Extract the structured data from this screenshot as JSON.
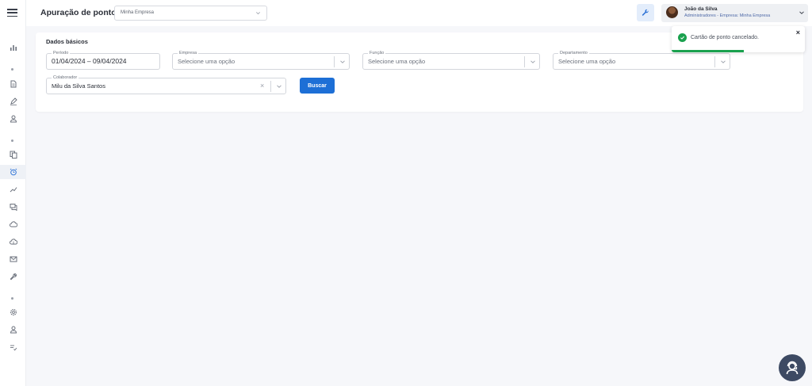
{
  "header": {
    "title": "Apuração de ponto",
    "company_select_value": "Minha Empresa"
  },
  "user": {
    "name": "João da Silva",
    "role": "Administradores - Empresa: Minha Empresa"
  },
  "card": {
    "title": "Dados básicos",
    "periodo": {
      "label": "Período",
      "value": "01/04/2024 – 09/04/2024"
    },
    "empresa": {
      "label": "Empresa",
      "placeholder": "Selecione uma opção"
    },
    "funcao": {
      "label": "Função",
      "placeholder": "Selecione uma opção"
    },
    "departamento": {
      "label": "Departamento",
      "placeholder": "Selecione uma opção"
    },
    "colaborador": {
      "label": "Colaborador",
      "value": "Milu da Silva Santos"
    },
    "search_button": "Buscar"
  },
  "toast": {
    "message": "Cartão de ponto cancelado.",
    "close_symbol": "×",
    "progress": 0.54
  },
  "colors": {
    "accent": "#1d6fd6",
    "success": "#1aa14e",
    "help_button": "#3d4a63"
  },
  "icons": {
    "sidebar": [
      "chart-icon",
      "document-icon",
      "pen-icon",
      "user-upload-icon",
      "copy-icon",
      "alarm-clock-icon",
      "trend-icon",
      "chat-icon",
      "cloud-icon",
      "cloud-upload-icon",
      "mail-icon",
      "wrench-icon",
      "settings-icon",
      "user-download-icon",
      "checklist-icon"
    ]
  }
}
